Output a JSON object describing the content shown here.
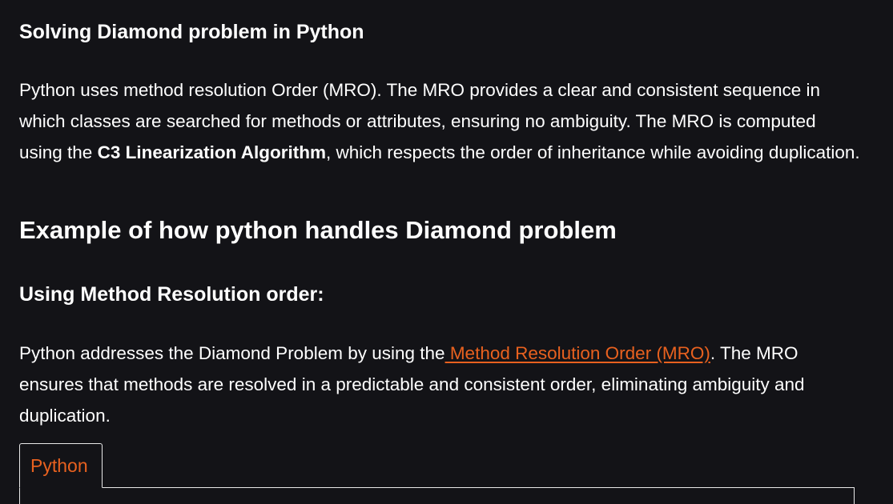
{
  "article": {
    "heading1": "Solving Diamond problem in Python",
    "para1": {
      "before_bold": "Python uses method resolution Order (MRO). The MRO provides a clear and consistent sequence in which classes are searched for methods or attributes, ensuring no ambiguity. The MRO is computed using the ",
      "bold": "C3 Linearization Algorithm",
      "after_bold": ", which respects the order of inheritance while avoiding duplication."
    },
    "heading2": "Example of how python handles Diamond problem",
    "heading3": "Using Method Resolution order:",
    "para2": {
      "before_link": "Python addresses the Diamond Problem by using the",
      "link_text": " Method Resolution Order (MRO)",
      "after_link": ". The MRO ensures that methods are resolved in a predictable and consistent order, eliminating ambiguity and duplication."
    },
    "code_tabs": [
      {
        "label": "Python"
      }
    ]
  },
  "colors": {
    "background": "#131317",
    "text": "#ffffff",
    "accent": "#e8611f",
    "border": "#e9e9e9"
  }
}
